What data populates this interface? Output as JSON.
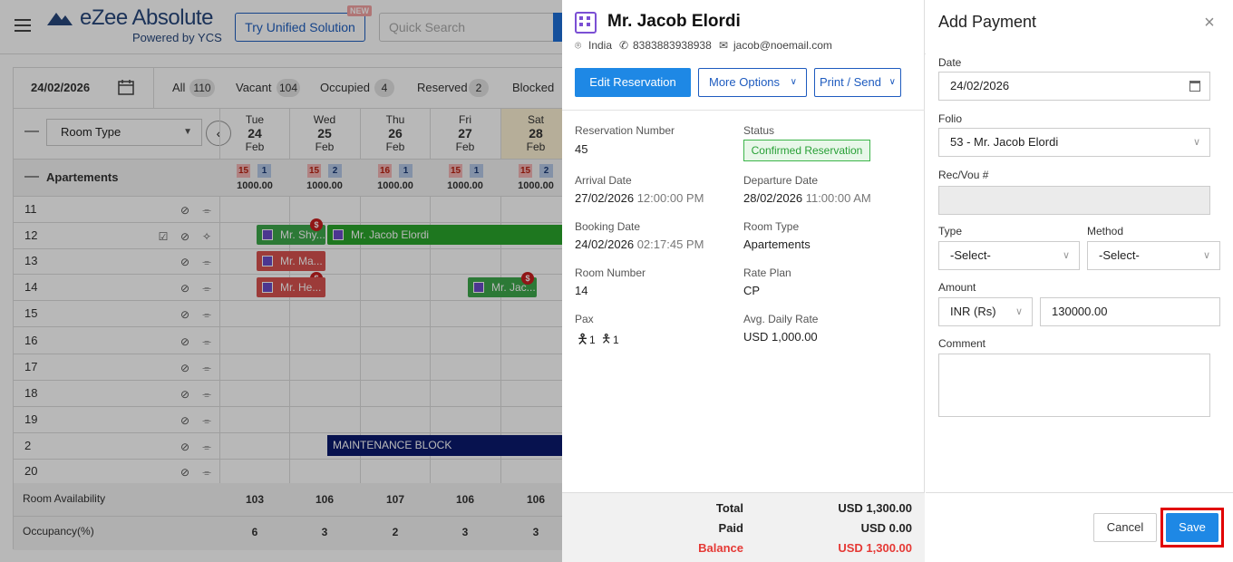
{
  "app": {
    "logo_name": "eZee Absolute",
    "logo_sub": "Powered by YCS",
    "try_label": "Try Unified Solution",
    "new_badge": "NEW",
    "search_placeholder": "Quick Search"
  },
  "grid": {
    "date": "24/02/2026",
    "filters": [
      {
        "label": "All",
        "count": "110"
      },
      {
        "label": "Vacant",
        "count": "104"
      },
      {
        "label": "Occupied",
        "count": "4"
      },
      {
        "label": "Reserved",
        "count": "2"
      },
      {
        "label": "Blocked",
        "count": ""
      }
    ],
    "room_type_select": "Room Type",
    "days": [
      {
        "dow": "Tue",
        "day": "24",
        "mon": "Feb",
        "red": "15",
        "blue": "1",
        "rate": "1000.00",
        "avail": "103",
        "occ": "6"
      },
      {
        "dow": "Wed",
        "day": "25",
        "mon": "Feb",
        "red": "15",
        "blue": "2",
        "rate": "1000.00",
        "avail": "106",
        "occ": "3"
      },
      {
        "dow": "Thu",
        "day": "26",
        "mon": "Feb",
        "red": "16",
        "blue": "1",
        "rate": "1000.00",
        "avail": "107",
        "occ": "2"
      },
      {
        "dow": "Fri",
        "day": "27",
        "mon": "Feb",
        "red": "15",
        "blue": "1",
        "rate": "1000.00",
        "avail": "106",
        "occ": "3"
      },
      {
        "dow": "Sat",
        "day": "28",
        "mon": "Feb",
        "red": "15",
        "blue": "2",
        "rate": "1000.00",
        "avail": "106",
        "occ": "3"
      }
    ],
    "group": "Apartements",
    "rooms": [
      "11",
      "12",
      "13",
      "14",
      "15",
      "16",
      "17",
      "18",
      "19",
      "2",
      "20"
    ],
    "bookings": {
      "b1": "Mr. Shy...",
      "b2": "Mr. Jacob Elordi",
      "b3": "Mr. Ma...",
      "b4": "Mr. He...",
      "b5": "Mr. Jac..."
    },
    "dollar_mark": "$",
    "maintenance": "MAINTENANCE BLOCK",
    "room_availability": "Room Availability",
    "occupancy": "Occupancy(%)"
  },
  "reservation": {
    "guest_name": "Mr. Jacob Elordi",
    "country": "India",
    "phone": "8383883938938",
    "email": "jacob@noemail.com",
    "edit_label": "Edit Reservation",
    "more_label": "More Options",
    "print_label": "Print / Send",
    "fields": {
      "res_num_label": "Reservation Number",
      "res_num": "45",
      "status_label": "Status",
      "status": "Confirmed Reservation",
      "arrival_label": "Arrival Date",
      "arrival_date": "27/02/2026",
      "arrival_time": "12:00:00 PM",
      "departure_label": "Departure Date",
      "departure_date": "28/02/2026",
      "departure_time": "11:00:00 AM",
      "booking_label": "Booking Date",
      "booking_date": "24/02/2026",
      "booking_time": "02:17:45 PM",
      "room_type_label": "Room Type",
      "room_type": "Apartements",
      "room_number_label": "Room Number",
      "room_number": "14",
      "rate_plan_label": "Rate Plan",
      "rate_plan": "CP",
      "pax_label": "Pax",
      "pax_adult": "1",
      "pax_child": "1",
      "adr_label": "Avg. Daily Rate",
      "adr": "USD 1,000.00"
    },
    "totals": {
      "total_label": "Total",
      "total": "USD 1,300.00",
      "paid_label": "Paid",
      "paid": "USD 0.00",
      "balance_label": "Balance",
      "balance": "USD 1,300.00"
    }
  },
  "payment": {
    "title": "Add Payment",
    "date_label": "Date",
    "date": "24/02/2026",
    "folio_label": "Folio",
    "folio": "53 - Mr. Jacob Elordi",
    "recvou_label": "Rec/Vou #",
    "recvou": "",
    "type_label": "Type",
    "type": "-Select-",
    "method_label": "Method",
    "method": "-Select-",
    "amount_label": "Amount",
    "currency": "INR (Rs)",
    "amount": "130000.00",
    "comment_label": "Comment",
    "comment": "",
    "cancel_label": "Cancel",
    "save_label": "Save"
  },
  "colors": {
    "accent": "#1e88e5",
    "highlight": "#e10000",
    "confirmed": "#28a036",
    "balance": "#e53935"
  }
}
